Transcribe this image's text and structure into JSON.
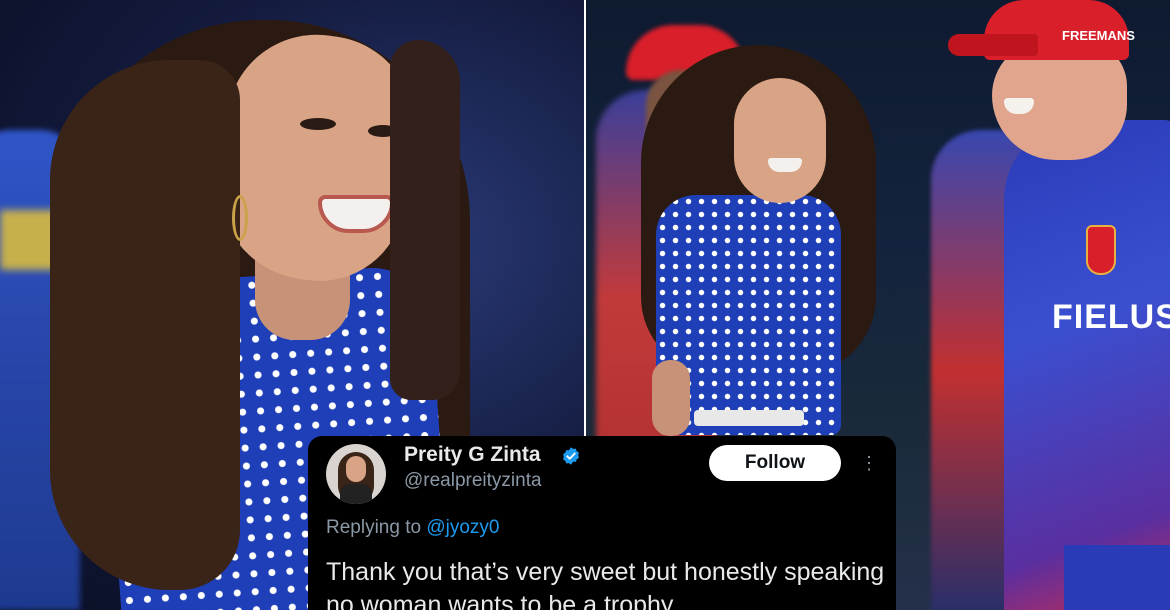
{
  "tweet": {
    "display_name": "Preity G Zinta",
    "handle": "@realpreityzinta",
    "follow_label": "Follow",
    "more_icon": "more-icon",
    "replying_prefix": "Replying to",
    "replying_to": "@jyozy0",
    "text": "Thank you that’s very sweet but honestly speaking no woman wants to be a trophy"
  },
  "photo_right": {
    "cap_text": "FREEMANS",
    "jersey_text": "FIELUS"
  },
  "colors": {
    "dress_blue": "#1f3fb8",
    "cap_red": "#d81f2a",
    "verified_blue": "#1d9bf0",
    "link_blue": "#1d9bf0"
  }
}
